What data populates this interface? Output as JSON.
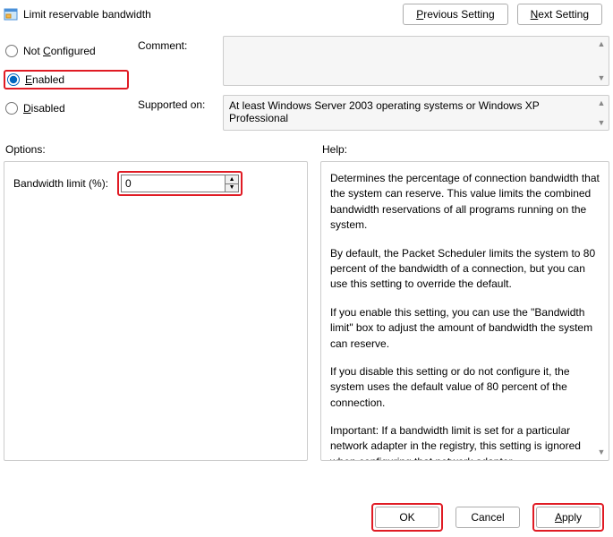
{
  "title": "Limit reservable bandwidth",
  "nav": {
    "previous": "Previous Setting",
    "next": "Next Setting",
    "previous_u": "P",
    "next_u": "N"
  },
  "state": {
    "not_configured": {
      "label": "Not Configured",
      "u": "C",
      "selected": false
    },
    "enabled": {
      "label": "Enabled",
      "u": "E",
      "selected": true
    },
    "disabled": {
      "label": "Disabled",
      "u": "D",
      "selected": false
    }
  },
  "labels": {
    "comment": "Comment:",
    "supported_on": "Supported on:",
    "options": "Options:",
    "help": "Help:",
    "bandwidth_limit": "Bandwidth limit (%):"
  },
  "comment_text": "",
  "supported_text": "At least Windows Server 2003 operating systems or Windows XP Professional",
  "options": {
    "bandwidth_limit_value": "0"
  },
  "help_text": {
    "p1": "Determines the percentage of connection bandwidth that the system can reserve. This value limits the combined bandwidth reservations of all programs running on the system.",
    "p2": "By default, the Packet Scheduler limits the system to 80 percent of the bandwidth of a connection, but you can use this setting to override the default.",
    "p3": "If you enable this setting, you can use the \"Bandwidth limit\" box to adjust the amount of bandwidth the system can reserve.",
    "p4": "If you disable this setting or do not configure it, the system uses the default value of 80 percent of the connection.",
    "p5": "Important: If a bandwidth limit is set for a particular network adapter in the registry, this setting is ignored when configuring that network adapter."
  },
  "buttons": {
    "ok": "OK",
    "cancel": "Cancel",
    "apply": "Apply",
    "apply_u": "A"
  }
}
